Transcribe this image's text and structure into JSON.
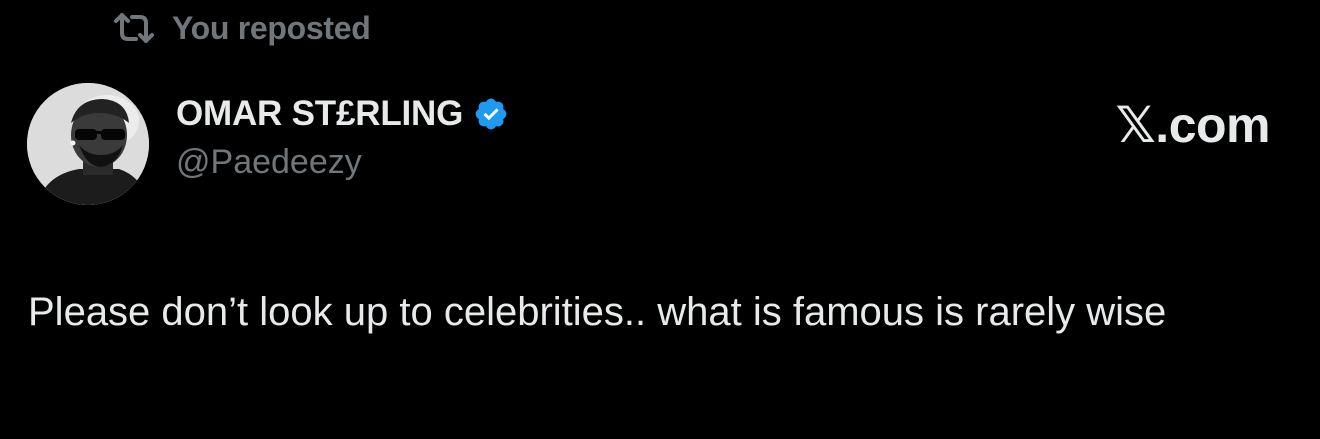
{
  "repost": {
    "label": "You reposted",
    "icon": "repost-icon"
  },
  "author": {
    "display_name": "OMAR ST£RLING",
    "handle": "@Paedeezy",
    "verified": true,
    "verified_color": "#1d9bf0",
    "avatar": "avatar-photo"
  },
  "site": {
    "label": "𝕏.com"
  },
  "post": {
    "text": "Please don’t look up to celebrities.. what is famous is rarely wise"
  },
  "colors": {
    "background": "#000000",
    "primary_text": "#e7e9ea",
    "secondary_text": "#71767b"
  }
}
